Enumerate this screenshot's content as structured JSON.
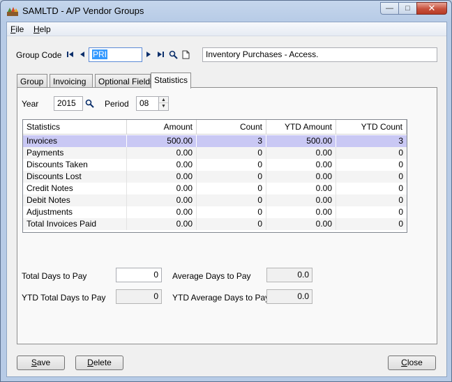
{
  "window": {
    "title": "SAMLTD - A/P Vendor Groups",
    "controls": {
      "minimize": "—",
      "maximize": "□",
      "close": "✕"
    }
  },
  "menu": [
    {
      "label": "File",
      "accel": "F",
      "rest": "ile"
    },
    {
      "label": "Help",
      "accel": "H",
      "rest": "elp"
    }
  ],
  "header": {
    "group_code_label": "Group Code",
    "group_code_value": "PRI",
    "description": "Inventory Purchases - Access.",
    "icons": [
      "first-record-icon",
      "previous-record-icon",
      "next-record-icon",
      "last-record-icon",
      "finder-icon",
      "new-document-icon"
    ]
  },
  "tabs": [
    {
      "label": "Group",
      "accel": ""
    },
    {
      "label": "Invoicing",
      "accel": ""
    },
    {
      "label": "Optional Fields",
      "accel": ""
    },
    {
      "label": "Statistics",
      "accel": "",
      "active": true
    }
  ],
  "filters": {
    "year_label": "Year",
    "year_value": "2015",
    "period_label": "Period",
    "period_value": "08"
  },
  "stats_table": {
    "columns": [
      "Statistics",
      "Amount",
      "Count",
      "YTD Amount",
      "YTD Count"
    ],
    "rows": [
      [
        "Invoices",
        "500.00",
        "3",
        "500.00",
        "3"
      ],
      [
        "Payments",
        "0.00",
        "0",
        "0.00",
        "0"
      ],
      [
        "Discounts Taken",
        "0.00",
        "0",
        "0.00",
        "0"
      ],
      [
        "Discounts Lost",
        "0.00",
        "0",
        "0.00",
        "0"
      ],
      [
        "Credit Notes",
        "0.00",
        "0",
        "0.00",
        "0"
      ],
      [
        "Debit Notes",
        "0.00",
        "0",
        "0.00",
        "0"
      ],
      [
        "Adjustments",
        "0.00",
        "0",
        "0.00",
        "0"
      ],
      [
        "Total Invoices Paid",
        "0.00",
        "0",
        "0.00",
        "0"
      ]
    ],
    "selected_row": 0
  },
  "summary": {
    "total_days_label": "Total Days to Pay",
    "total_days_value": "0",
    "avg_days_label": "Average Days to Pay",
    "avg_days_value": "0.0",
    "ytd_total_days_label": "YTD Total Days to Pay",
    "ytd_total_days_value": "0",
    "ytd_avg_days_label": "YTD Average Days to Pay",
    "ytd_avg_days_value": "0.0"
  },
  "buttons": {
    "save": {
      "label": "Save",
      "accel": "S",
      "rest": "ave"
    },
    "delete": {
      "label": "Delete",
      "accel": "D",
      "rest": "elete"
    },
    "close": {
      "label": "Close",
      "accel": "C",
      "rest": "lose"
    }
  },
  "colors": {
    "selected_row": "#c9c8f4",
    "selection_highlight": "#3399ff",
    "title_bar": "#b7cbe6",
    "close_button": "#c7503c"
  }
}
